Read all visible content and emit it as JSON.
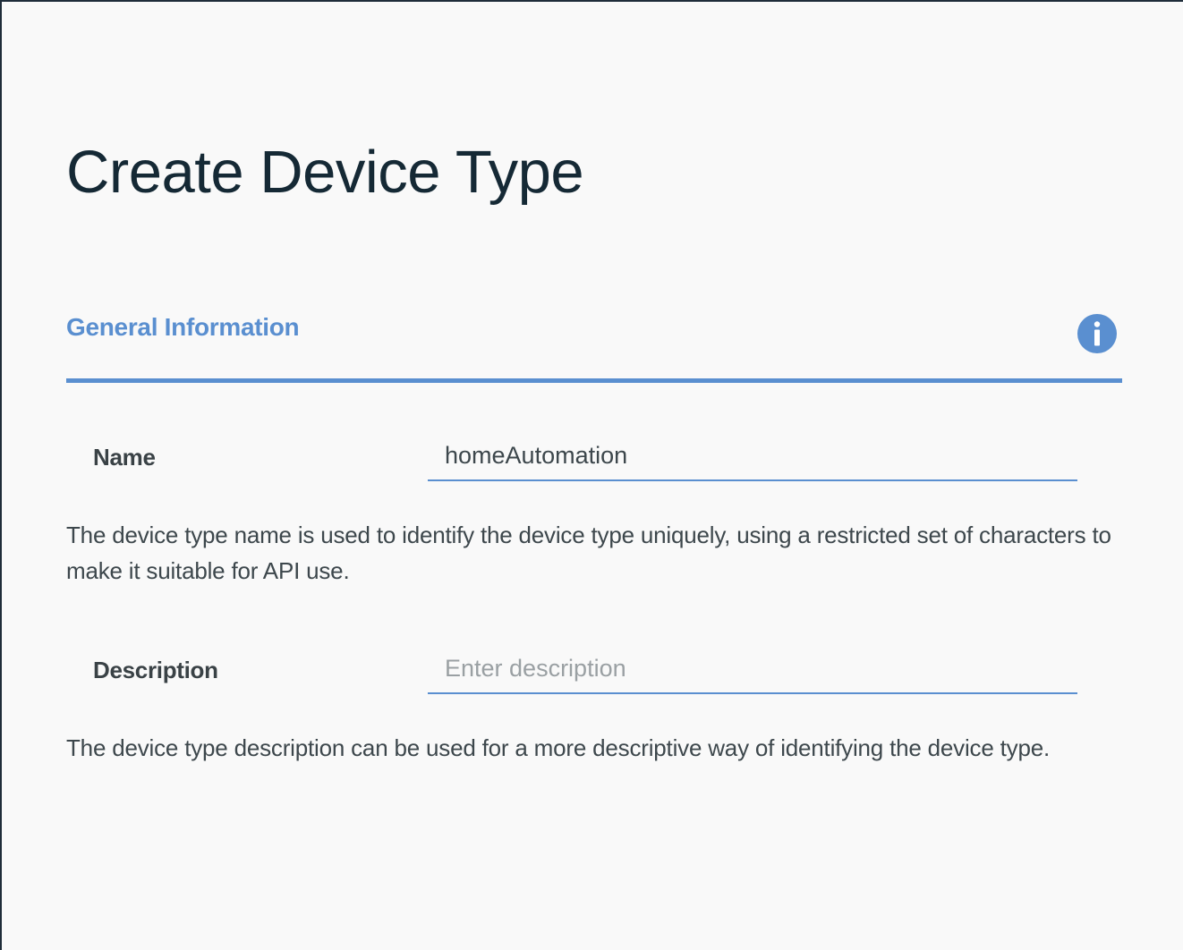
{
  "page": {
    "title": "Create Device Type"
  },
  "section": {
    "title": "General Information",
    "info_icon": "info-icon"
  },
  "fields": {
    "name": {
      "label": "Name",
      "value": "homeAutomation",
      "help": "The device type name is used to identify the device type uniquely, using a restricted set of characters to make it suitable for API use."
    },
    "description": {
      "label": "Description",
      "value": "",
      "placeholder": "Enter description",
      "help": "The device type description can be used for a more descriptive way of identifying the device type."
    }
  },
  "colors": {
    "accent": "#5a8fd0",
    "title": "#152935",
    "text": "#3d474c",
    "background": "#f9f9f9"
  }
}
